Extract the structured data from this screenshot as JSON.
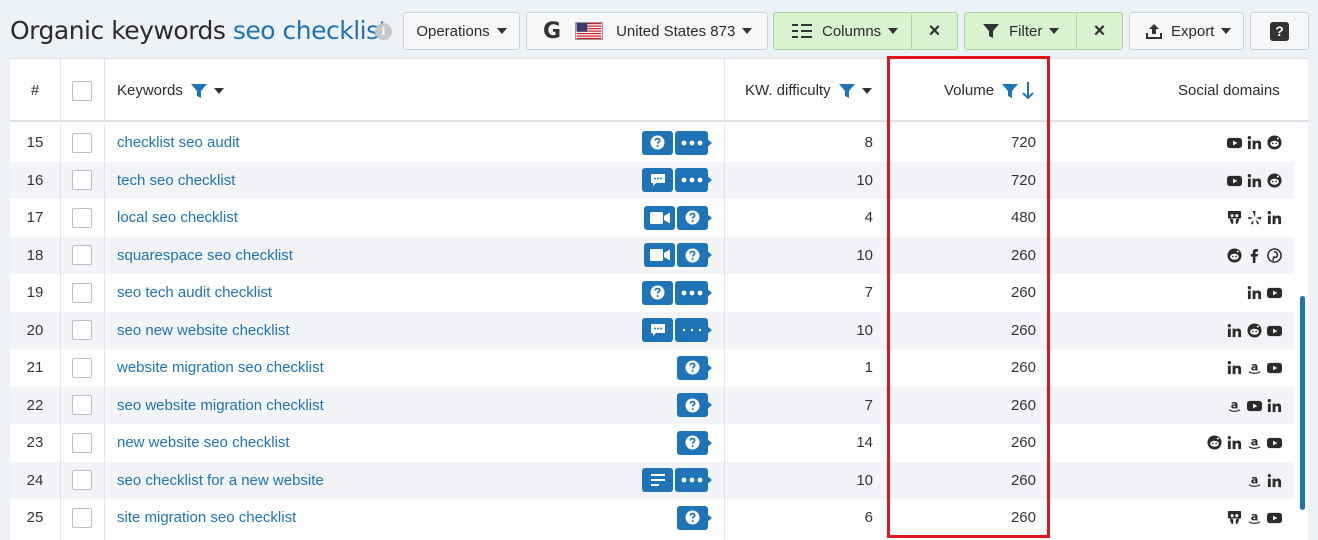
{
  "header": {
    "title_prefix": "Organic keywords",
    "title_query": "seo checklist",
    "info_icon": "i",
    "operations_label": "Operations",
    "database_label": "United States 873",
    "google_letter": "G",
    "columns_label": "Columns",
    "filter_label": "Filter",
    "export_label": "Export",
    "help_label": "?",
    "close_glyph": "×"
  },
  "table": {
    "headers": {
      "num": "#",
      "keywords": "Keywords",
      "kd": "KW. difficulty",
      "volume": "Volume",
      "social": "Social domains"
    },
    "rows": [
      {
        "n": "15",
        "kw": "checklist seo audit",
        "icons": [
          "question",
          "dots"
        ],
        "kd": "8",
        "vol": "720",
        "social": [
          "youtube",
          "linkedin",
          "reddit"
        ]
      },
      {
        "n": "16",
        "kw": "tech seo checklist",
        "icons": [
          "comment",
          "dots"
        ],
        "kd": "10",
        "vol": "720",
        "social": [
          "youtube",
          "linkedin",
          "reddit"
        ]
      },
      {
        "n": "17",
        "kw": "local seo checklist",
        "icons": [
          "video",
          "question"
        ],
        "kd": "4",
        "vol": "480",
        "social": [
          "slideshare",
          "yelp",
          "linkedin"
        ]
      },
      {
        "n": "18",
        "kw": "squarespace seo checklist",
        "icons": [
          "video",
          "question"
        ],
        "kd": "10",
        "vol": "260",
        "social": [
          "reddit",
          "facebook",
          "pinterest"
        ]
      },
      {
        "n": "19",
        "kw": "seo tech audit checklist",
        "icons": [
          "question",
          "dots"
        ],
        "kd": "7",
        "vol": "260",
        "social": [
          "linkedin",
          "youtube"
        ]
      },
      {
        "n": "20",
        "kw": "seo new website checklist",
        "icons": [
          "comment",
          "dots-thin"
        ],
        "kd": "10",
        "vol": "260",
        "social": [
          "linkedin",
          "reddit",
          "youtube"
        ]
      },
      {
        "n": "21",
        "kw": "website migration seo checklist",
        "icons": [
          "question"
        ],
        "kd": "1",
        "vol": "260",
        "social": [
          "linkedin",
          "amazon",
          "youtube"
        ]
      },
      {
        "n": "22",
        "kw": "seo website migration checklist",
        "icons": [
          "question"
        ],
        "kd": "7",
        "vol": "260",
        "social": [
          "amazon",
          "youtube",
          "linkedin"
        ]
      },
      {
        "n": "23",
        "kw": "new website seo checklist",
        "icons": [
          "question"
        ],
        "kd": "14",
        "vol": "260",
        "social": [
          "reddit",
          "linkedin",
          "amazon",
          "youtube"
        ]
      },
      {
        "n": "24",
        "kw": "seo checklist for a new website",
        "icons": [
          "lines",
          "dots"
        ],
        "kd": "10",
        "vol": "260",
        "social": [
          "amazon",
          "linkedin"
        ]
      },
      {
        "n": "25",
        "kw": "site migration seo checklist",
        "icons": [
          "question"
        ],
        "kd": "6",
        "vol": "260",
        "social": [
          "slideshare",
          "amazon",
          "youtube"
        ]
      }
    ]
  },
  "colors": {
    "accent": "#1f73b7",
    "green_button": "#d9f2cf",
    "highlight_box": "#e3141b",
    "row_alt": "#f2f4f7"
  },
  "sort": {
    "column": "volume",
    "direction": "descending"
  }
}
